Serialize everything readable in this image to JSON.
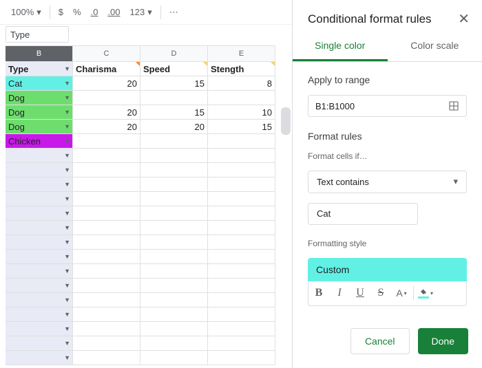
{
  "toolbar": {
    "zoom": "100%",
    "currency": "$",
    "percent": "%",
    "dec_dec": ".0",
    "inc_dec": ".00",
    "numfmt": "123",
    "more": "⋯"
  },
  "namebox": "Type",
  "columns": [
    "B",
    "C",
    "D",
    "E"
  ],
  "headers": {
    "b": "Type",
    "c": "Charisma",
    "d": "Speed",
    "e": "Stength"
  },
  "rows": [
    {
      "b": "Cat",
      "c": "20",
      "d": "15",
      "e": "8",
      "bcolor": "#62f0e5"
    },
    {
      "b": "Dog",
      "c": "",
      "d": "",
      "e": "",
      "bcolor": "#6dde6e"
    },
    {
      "b": "Dog",
      "c": "20",
      "d": "15",
      "e": "10",
      "bcolor": "#6dde6e"
    },
    {
      "b": "Dog",
      "c": "20",
      "d": "20",
      "e": "15",
      "bcolor": "#6dde6e"
    },
    {
      "b": "Chicken",
      "c": "",
      "d": "",
      "e": "",
      "bcolor": "#c71ae8"
    }
  ],
  "panel": {
    "title": "Conditional format rules",
    "tab_single": "Single color",
    "tab_scale": "Color scale",
    "apply_label": "Apply to range",
    "range": "B1:B1000",
    "rules_label": "Format rules",
    "cells_if": "Format cells if…",
    "condition": "Text contains",
    "value": "Cat",
    "style_label": "Formatting style",
    "style_name": "Custom",
    "cancel": "Cancel",
    "done": "Done"
  }
}
